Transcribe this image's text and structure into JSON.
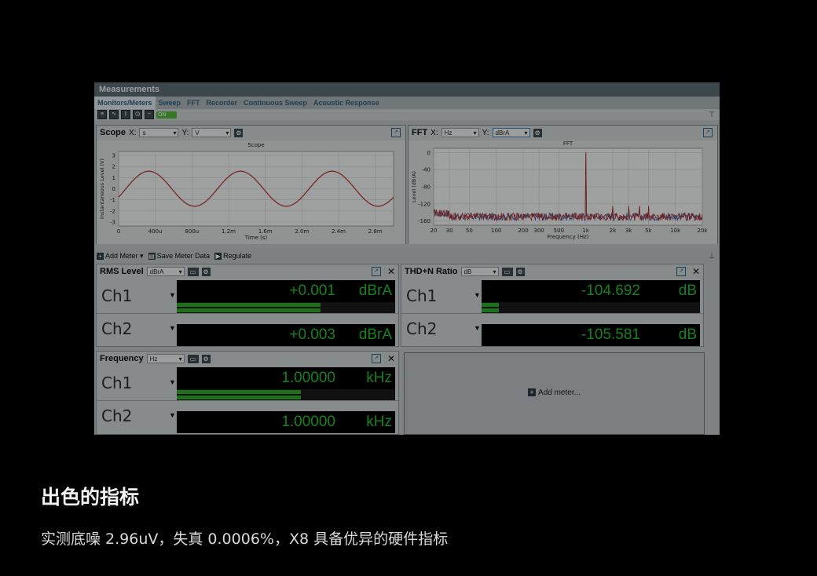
{
  "app": {
    "title": "Measurements",
    "tabs": [
      "Monitors/Meters",
      "Sweep",
      "FFT",
      "Recorder",
      "Continuous Sweep",
      "Acoustic Response"
    ],
    "on_label": "ON"
  },
  "scope": {
    "name": "Scope",
    "x_label": "X:",
    "x_unit": "s",
    "y_label": "Y:",
    "y_unit": "V",
    "plot_title": "Scope",
    "xlabel": "Time (s)",
    "ylabel": "Instantaneous Level (V)",
    "xticks": [
      "0",
      "400u",
      "800u",
      "1.2m",
      "1.6m",
      "2.0m",
      "2.4m",
      "2.8m"
    ],
    "yticks": [
      "3",
      "2",
      "1",
      "0",
      "-1",
      "-2",
      "-3"
    ]
  },
  "fft": {
    "name": "FFT",
    "x_label": "X:",
    "x_unit": "Hz",
    "y_label": "Y:",
    "y_unit": "dBrA",
    "plot_title": "FFT",
    "xlabel": "Frequency (Hz)",
    "ylabel": "Level (dBrA)",
    "xticks": [
      "20",
      "30",
      "50",
      "100",
      "200",
      "300",
      "500",
      "1k",
      "2k",
      "3k",
      "5k",
      "10k",
      "20k"
    ],
    "yticks": [
      "0",
      "-40",
      "-80",
      "-120",
      "-160"
    ]
  },
  "meter_toolbar": {
    "add_meter": "Add Meter",
    "save_meter_data": "Save Meter Data",
    "regulate": "Regulate"
  },
  "rms": {
    "name": "RMS Level",
    "unit_select": "dBrA",
    "ch1": {
      "label": "Ch1",
      "value": "+0.001",
      "unit": "dBrA"
    },
    "ch2": {
      "label": "Ch2",
      "value": "+0.003",
      "unit": "dBrA"
    }
  },
  "thdn": {
    "name": "THD+N Ratio",
    "unit_select": "dB",
    "ch1": {
      "label": "Ch1",
      "value": "-104.692",
      "unit": "dB"
    },
    "ch2": {
      "label": "Ch2",
      "value": "-105.581",
      "unit": "dB"
    }
  },
  "freq": {
    "name": "Frequency",
    "unit_select": "Hz",
    "ch1": {
      "label": "Ch1",
      "value": "1.00000",
      "unit": "kHz"
    },
    "ch2": {
      "label": "Ch2",
      "value": "1.00000",
      "unit": "kHz"
    }
  },
  "add_meter_placeholder": "Add meter...",
  "caption": {
    "title": "出色的指标",
    "subtitle": "实测底噪 2.96uV，失真 0.0006%，X8 具备优异的硬件指标"
  }
}
